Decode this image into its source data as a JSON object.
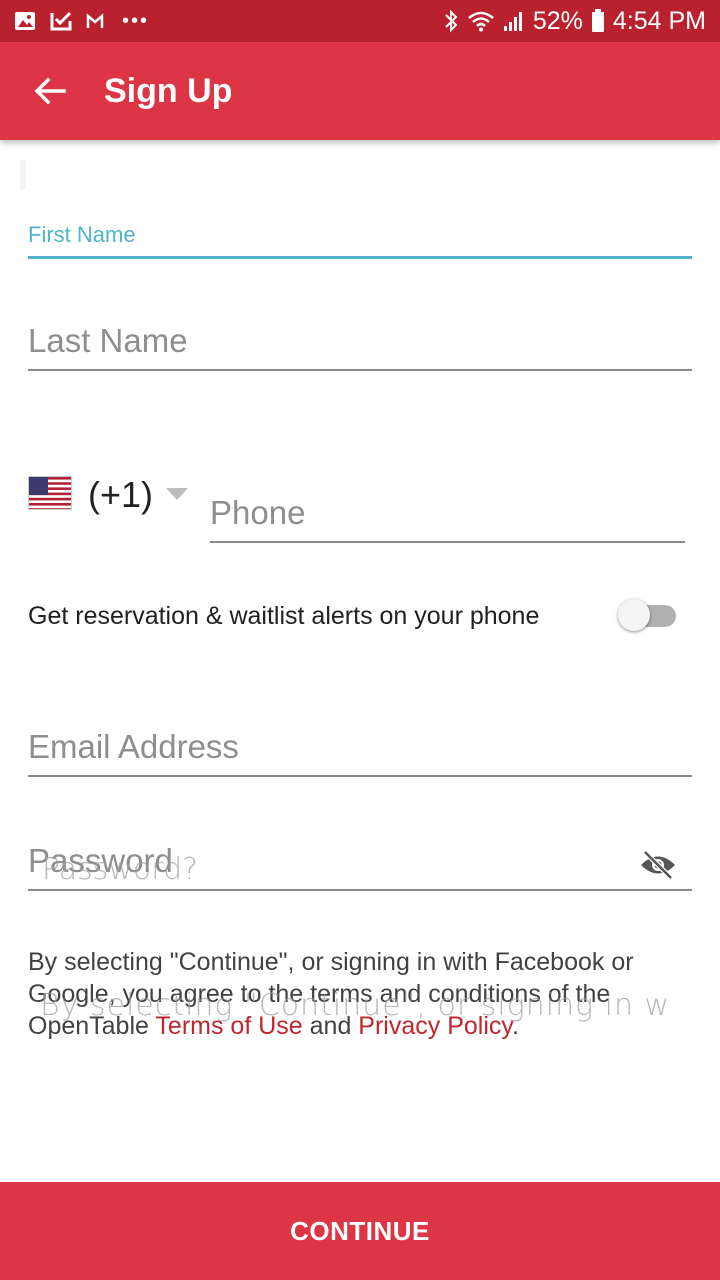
{
  "status_bar": {
    "battery": "52%",
    "time": "4:54 PM",
    "more": "•••"
  },
  "app_bar": {
    "title": "Sign Up"
  },
  "form": {
    "first_name_label": "First Name",
    "last_name_placeholder": "Last Name",
    "country_code": "(+1)",
    "phone_placeholder": "Phone",
    "alerts_label": "Get reservation & waitlist alerts on your phone",
    "alerts_enabled": false,
    "email_placeholder": "Email Address",
    "password_placeholder": "Password",
    "password_ghost": "Password?"
  },
  "terms": {
    "prefix": "By selecting \"Continue\", or signing in with Facebook or Google, you agree to the terms and conditions of the OpenTable ",
    "terms_link": "Terms of Use",
    "middle": " and ",
    "privacy_link": "Privacy Policy",
    "suffix": ".",
    "ghost": "By selecting \"Continue\", or signing in w"
  },
  "continue_label": "CONTINUE",
  "colors": {
    "brand": "#dc3545",
    "status_bar": "#b8212d",
    "focus": "#4fb4c8",
    "link": "#c0272d"
  }
}
